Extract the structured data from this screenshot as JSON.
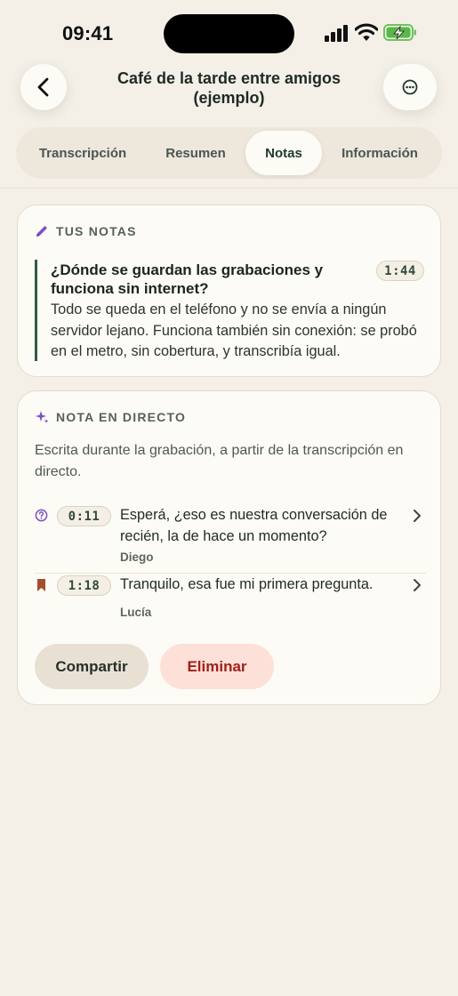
{
  "status_bar": {
    "time": "09:41"
  },
  "header": {
    "title_line1": "Café de la tarde entre amigos",
    "title_line2": "(ejemplo)",
    "back_icon": "chevron-left-icon",
    "more_icon": "ellipsis-circle-icon"
  },
  "tabs": [
    {
      "label": "Transcripción",
      "active": false
    },
    {
      "label": "Resumen",
      "active": false
    },
    {
      "label": "Notas",
      "active": true
    },
    {
      "label": "Información",
      "active": false
    }
  ],
  "your_notes": {
    "label": "TUS NOTAS",
    "icon": "pencil-icon",
    "note": {
      "title": "¿Dónde se guardan las grabaciones y funciona sin internet?",
      "timestamp": "1:44",
      "body": "Todo se queda en el teléfono y no se envía a ningún servidor lejano. Funciona también sin conexión: se probó en el metro, sin cobertura, y transcribía igual."
    }
  },
  "live_note": {
    "label": "NOTA EN DIRECTO",
    "icon": "sparkle-icon",
    "description": "Escrita durante la grabación, a partir de la transcripción en directo.",
    "entries": [
      {
        "icon": "question-circle-icon",
        "timestamp": "0:11",
        "text": "Esperá, ¿eso es nuestra conversación de recién, la de hace un momento?",
        "speaker": "Diego"
      },
      {
        "icon": "bookmark-icon",
        "timestamp": "1:18",
        "text": "Tranquilo, esa fue mi primera pregunta.",
        "speaker": "Lucía"
      }
    ],
    "share_label": "Compartir",
    "delete_label": "Eliminar"
  },
  "colors": {
    "background": "#f4f0e8",
    "accent_green": "#2f5a44",
    "accent_purple": "#7a4fc4",
    "bookmark": "#a3502a",
    "delete_text": "#a11f1a"
  }
}
